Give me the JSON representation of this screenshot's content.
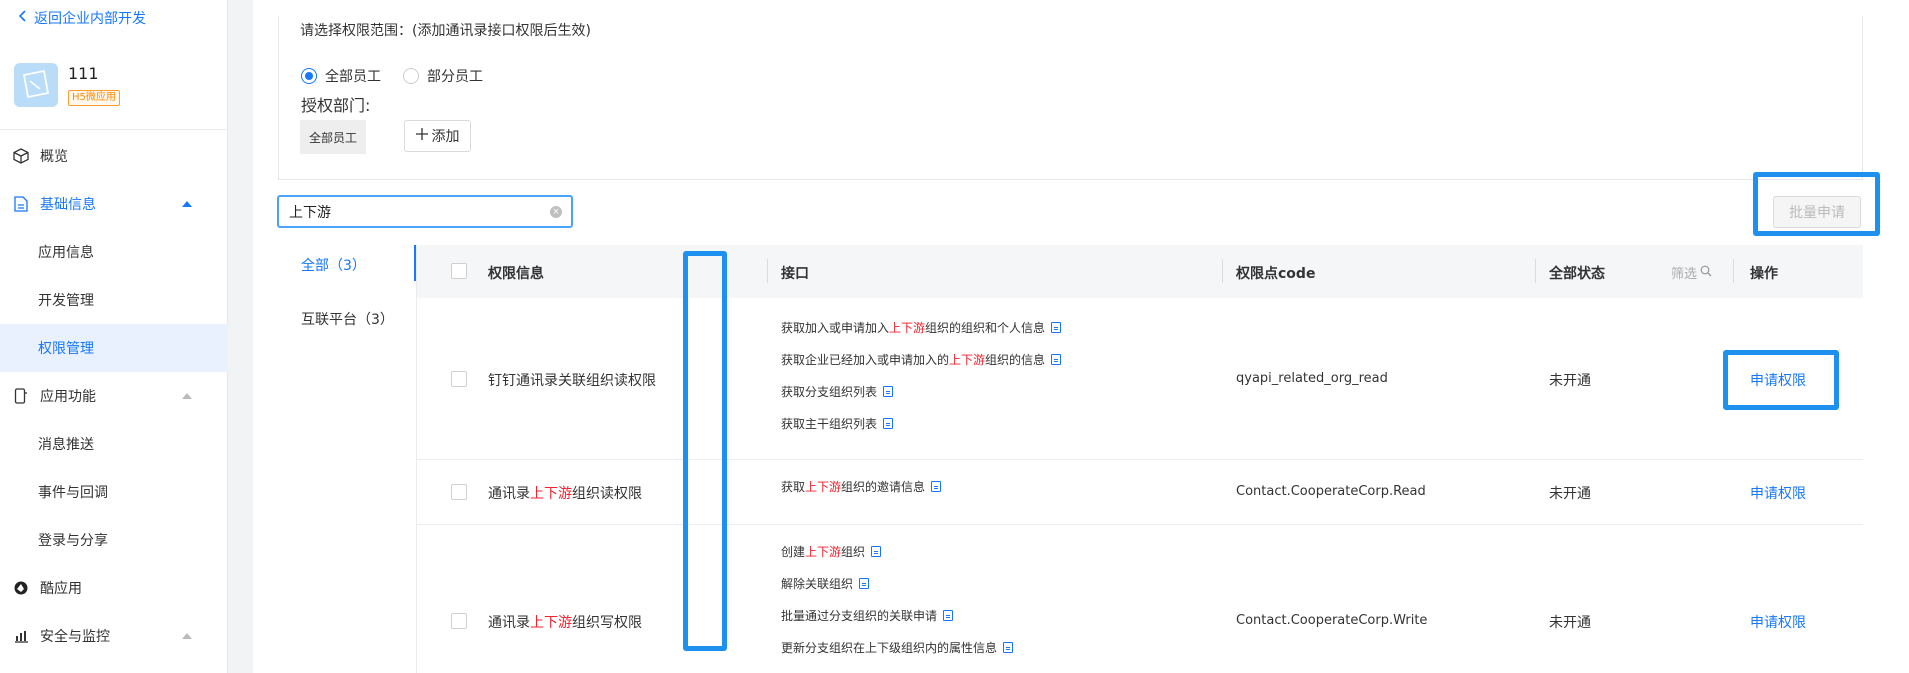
{
  "sidebar": {
    "back_label": "返回企业内部开发",
    "app": {
      "name": "111",
      "badge": "H5微应用"
    },
    "nav": [
      {
        "label": "概览",
        "icon": "cube-icon"
      },
      {
        "label": "基础信息",
        "icon": "document-icon"
      },
      {
        "label": "应用功能",
        "icon": "phone-icon"
      },
      {
        "label": "酷应用",
        "icon": "cool-app-icon"
      },
      {
        "label": "安全与监控",
        "icon": "bar-chart-icon"
      }
    ],
    "sub_basic": [
      "应用信息",
      "开发管理",
      "权限管理"
    ],
    "sub_features": [
      "消息推送",
      "事件与回调",
      "登录与分享"
    ]
  },
  "scope": {
    "title": "请选择权限范围：(添加通讯录接口权限后生效)",
    "radio_all": "全部员工",
    "radio_part": "部分员工",
    "dept_label": "授权部门:",
    "dept_tag": "全部员工",
    "add_label": "添加"
  },
  "search": {
    "value": "上下游"
  },
  "batch_label": "批量申请",
  "categories": [
    {
      "label": "全部（3）"
    },
    {
      "label": "互联平台（3）"
    }
  ],
  "table": {
    "headers": {
      "perm": "权限信息",
      "api": "接口",
      "code": "权限点code",
      "status": "全部状态",
      "filter": "筛选",
      "action": "操作"
    },
    "rows": [
      {
        "name": [
          "钉钉通讯录关联组织读权限"
        ],
        "apis": [
          [
            "获取加入或申请加入",
            "上下游",
            "组织的组织和个人信息"
          ],
          [
            "获取企业已经加入或申请加入的",
            "上下游",
            "组织的信息"
          ],
          [
            "获取分支组织列表",
            "",
            ""
          ],
          [
            "获取主干组织列表",
            "",
            ""
          ]
        ],
        "code": "qyapi_related_org_read",
        "status": "未开通",
        "action": "申请权限"
      },
      {
        "name": [
          "通讯录",
          "上下游",
          "组织读权限"
        ],
        "apis": [
          [
            "获取",
            "上下游",
            "组织的邀请信息"
          ]
        ],
        "code": "Contact.CooperateCorp.Read",
        "status": "未开通",
        "action": "申请权限"
      },
      {
        "name": [
          "通讯录",
          "上下游",
          "组织写权限"
        ],
        "apis": [
          [
            "创建",
            "上下游",
            "组织"
          ],
          [
            "解除关联组织",
            "",
            ""
          ],
          [
            "批量通过分支组织的关联申请",
            "",
            ""
          ],
          [
            "更新分支组织在上下级组织内的属性信息",
            "",
            ""
          ]
        ],
        "code": "Contact.CooperateCorp.Write",
        "status": "未开通",
        "action": "申请权限"
      }
    ]
  },
  "colors": {
    "accent": "#1677ff",
    "highlight": "#1e90ef",
    "keyword": "#f5222d"
  }
}
